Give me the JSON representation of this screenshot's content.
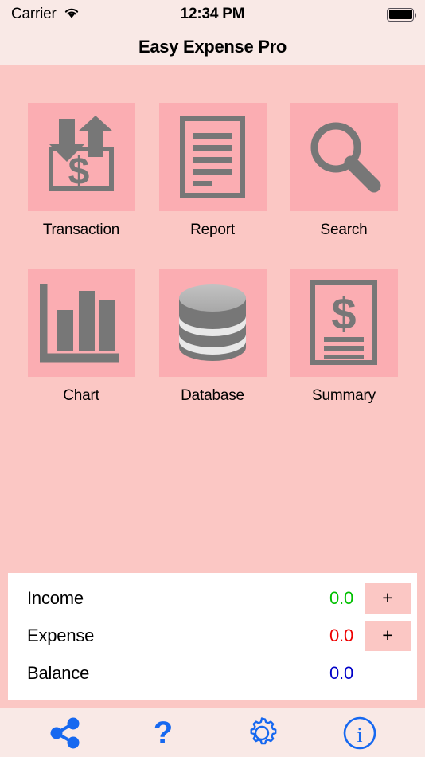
{
  "status_bar": {
    "carrier": "Carrier",
    "wifi_icon": "wifi-icon",
    "time": "12:34 PM",
    "battery_icon": "battery-full-icon"
  },
  "nav": {
    "title": "Easy Expense Pro"
  },
  "theme": {
    "page_background": "#fbc7c4",
    "bar_background": "#f9e9e6",
    "tile_background": "#fbadb2",
    "icon_gray": "#777777",
    "card_background": "#ffffff",
    "income_color": "#00c000",
    "expense_color": "#ee0000",
    "balance_color": "#0000c8",
    "tab_icon_color": "#1668f0"
  },
  "grid": {
    "rows": [
      [
        {
          "label": "Transaction",
          "icon": "transaction-arrows-dollar-icon"
        },
        {
          "label": "Report",
          "icon": "document-lines-icon"
        },
        {
          "label": "Search",
          "icon": "magnifier-icon"
        }
      ],
      [
        {
          "label": "Chart",
          "icon": "bar-chart-icon"
        },
        {
          "label": "Database",
          "icon": "database-cylinder-icon"
        },
        {
          "label": "Summary",
          "icon": "document-dollar-icon"
        }
      ]
    ]
  },
  "summary": {
    "rows": [
      {
        "label": "Income",
        "value": "0.0",
        "add_label": "+",
        "has_add": true
      },
      {
        "label": "Expense",
        "value": "0.0",
        "add_label": "+",
        "has_add": true
      },
      {
        "label": "Balance",
        "value": "0.0",
        "add_label": "",
        "has_add": false
      }
    ]
  },
  "tab_bar": {
    "items": [
      {
        "icon": "share-icon"
      },
      {
        "icon": "question-mark-help-icon"
      },
      {
        "icon": "gear-settings-icon"
      },
      {
        "icon": "info-circle-icon"
      }
    ]
  }
}
